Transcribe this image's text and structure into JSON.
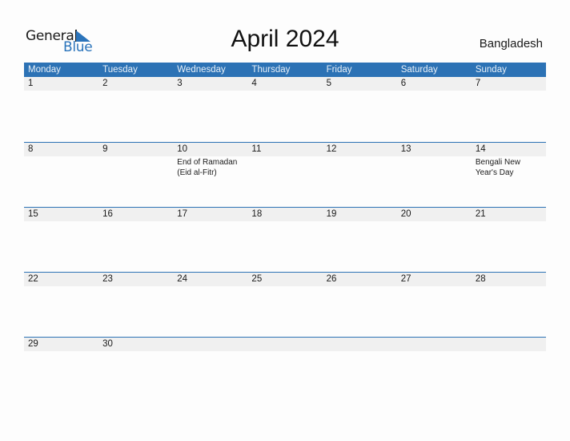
{
  "logo": {
    "general": "General",
    "blue": "Blue",
    "brand_color": "#2b74bb"
  },
  "title": "April 2024",
  "country": "Bangladesh",
  "header_color": "#2c72b5",
  "days": [
    "Monday",
    "Tuesday",
    "Wednesday",
    "Thursday",
    "Friday",
    "Saturday",
    "Sunday"
  ],
  "weeks": [
    {
      "dates": [
        "1",
        "2",
        "3",
        "4",
        "5",
        "6",
        "7"
      ],
      "events": [
        "",
        "",
        "",
        "",
        "",
        "",
        ""
      ]
    },
    {
      "dates": [
        "8",
        "9",
        "10",
        "11",
        "12",
        "13",
        "14"
      ],
      "events": [
        "",
        "",
        "End of Ramadan (Eid al-Fitr)",
        "",
        "",
        "",
        "Bengali New Year's Day"
      ]
    },
    {
      "dates": [
        "15",
        "16",
        "17",
        "18",
        "19",
        "20",
        "21"
      ],
      "events": [
        "",
        "",
        "",
        "",
        "",
        "",
        ""
      ]
    },
    {
      "dates": [
        "22",
        "23",
        "24",
        "25",
        "26",
        "27",
        "28"
      ],
      "events": [
        "",
        "",
        "",
        "",
        "",
        "",
        ""
      ]
    },
    {
      "dates": [
        "29",
        "30",
        "",
        "",
        "",
        "",
        ""
      ],
      "events": [
        "",
        "",
        "",
        "",
        "",
        "",
        ""
      ]
    }
  ]
}
